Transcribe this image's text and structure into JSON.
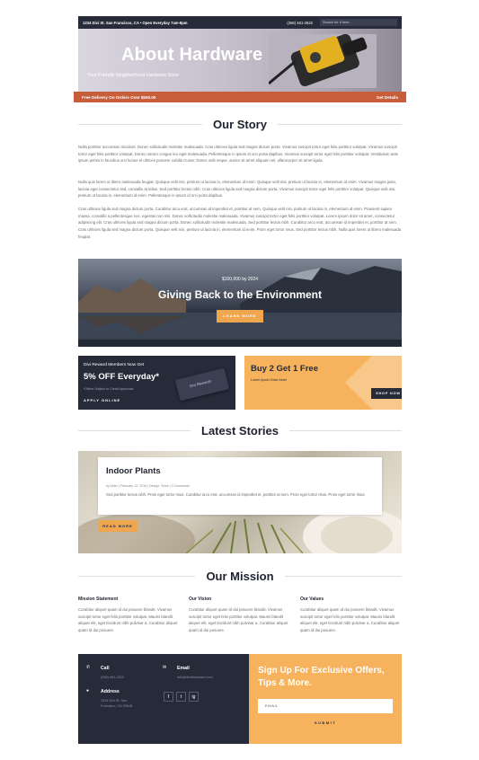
{
  "topbar": {
    "address": "1234 Divi St. San Francisco, CA • Open Everyday 7am-8pm",
    "phone": "(256) 461-2622",
    "search_placeholder": "Search for It here..."
  },
  "hero": {
    "title": "About Hardware",
    "subtitle": "Your Friendly Neighborhood Hardware Store"
  },
  "delivery_bar": {
    "text": "Free Delivery On Orders Over $500.00",
    "link": "Get Details"
  },
  "our_story": {
    "heading": "Our Story",
    "paragraphs": [
      "Nulla porttitor accumsan tincidunt. Donec sollicitudin molestie malesuada. Cras ultricies ligula sed magna dictum porta. Vivamus suscipit tortor eget felis porttitor volutpat. Vivamus suscipit tortor eget felis porttitor volutpat. Donec rutrum congue leo eget malesuada. Pellentesque in ipsum id orci porta dapibus. Vivamus suscipit tortor eget felis porttitor volutpat. Vestibulum ante ipsum primis in faucibus orci luctus et ultrices posuere cubilia Curae; Donec velit neque, auctor sit amet aliquam vel, ullamcorper sit amet ligula.",
      "Nulla quis lorem ut libero malesuada feugiat. Quisque velit nisi, pretium ut lacinia in, elementum id enim. Quisque velit nisi, pretium ut lacinia in, elementum id enim. Vivamus magna justo, lacinia eget consectetur sed, convallis at tellus. Sed porttitor lectus nibh. Cras ultricies ligula sed magna dictum porta. Vivamus suscipit tortor eget felis porttitor volutpat. Quisque velit nisi, pretium ut lacinia in, elementum id enim. Pellentesque in ipsum id orci porta dapibus.",
      "Cras ultricies ligula sed magna dictum porta. Curabitur arcu erat, accumsan id imperdiet et, porttitor at sem. Quisque velit nisi, pretium ut lacinia in, elementum id enim. Praesent sapien massa, convallis a pellentesque nec, egestas non nisi. Donec sollicitudin molestie malesuada. Vivamus suscipit tortor eget felis porttitor volutpat. Lorem ipsum dolor sit amet, consectetur adipiscing elit. Cras ultricies ligula sed magna dictum porta. Donec sollicitudin molestie malesuada. Sed porttitor lectus nibh. Curabitur arcu erat, accumsan id imperdiet et, porttitor at sem. Cras ultricies ligula sed magna dictum porta. Quisque velit nisi, pretium ut lacinia in, elementum id enim. Proin eget tortor risus. Sed porttitor lectus nibh. Nulla quis lorem ut libero malesuada feugiat."
    ]
  },
  "environment": {
    "amount": "$100,000 by 2024",
    "title": "Giving Back to the Environment",
    "button": "LEARN MORE"
  },
  "promo_rewards": {
    "heading": "Divi Reward Members Now Get",
    "offer": "5% OFF Everyday*",
    "fine_print": "*Offers Subject to Credit Approvals",
    "cta": "APPLY ONLINE",
    "card_label": "Divi Rewards"
  },
  "promo_deal": {
    "title": "Buy 2 Get 1 Free",
    "subtitle": "Lorem Ipsum Dolor Amet",
    "button": "SHOP NOW"
  },
  "latest_stories": {
    "heading": "Latest Stories",
    "post_title": "Indoor Plants",
    "post_meta": "by elder | February 12, 2018 | Design, Store | 0 Comments",
    "post_excerpt": "Sed porttitor lectus nibh. Proin eget tortor risus. Curabitur arcu erat, accumsan id imperdiet et, porttitor at sem. Proin eget tortor risus. Proin eget tortor risus.",
    "read_more": "READ MORE"
  },
  "our_mission": {
    "heading": "Our Mission",
    "columns": [
      {
        "title": "Mission Statement",
        "text": "Curabitur aliquet quam id dui posuere blandit. Vivamus suscipit tortor eget felis porttitor volutpat. Mauris blandit aliquet elit, eget tincidunt nibh pulvinar a. Curabitur aliquet quam id dui posuere."
      },
      {
        "title": "Our Vision",
        "text": "Curabitur aliquet quam id dui posuere blandit. Vivamus suscipit tortor eget felis porttitor volutpat. Mauris blandit aliquet elit, eget tincidunt nibh pulvinar a. Curabitur aliquet quam id dui posuere."
      },
      {
        "title": "Our Values",
        "text": "Curabitur aliquet quam id dui posuere blandit. Vivamus suscipit tortor eget felis porttitor volutpat. Mauris blandit aliquet elit, eget tincidunt nibh pulvinar a. Curabitur aliquet quam id dui posuere."
      }
    ]
  },
  "footer": {
    "call_label": "Call",
    "call_value": "(256) 461-2622",
    "email_label": "Email",
    "email_value": "info@divihardware.com",
    "address_label": "Address",
    "address_line1": "1234 Divi St. San",
    "address_line2": "Francisco, CA 93548",
    "social": [
      "f",
      "t",
      "ig"
    ],
    "signup_title": "Sign Up For Exclusive Offers, Tips & More.",
    "email_placeholder": "EMAIL",
    "submit": "SUBMIT"
  },
  "colors": {
    "navy": "#262a39",
    "orange": "#f6b25c",
    "rust": "#c75d3a"
  }
}
